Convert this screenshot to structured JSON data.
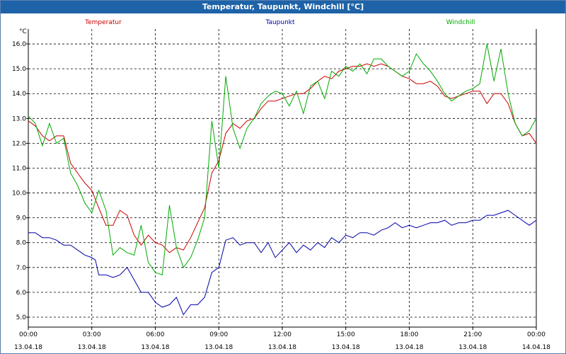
{
  "window_title": "Temperatur, Taupunkt, Windchill [°C]",
  "chart_data": {
    "type": "line",
    "title": "Temperatur, Taupunkt, Windchill [°C]",
    "ylabel": "°C",
    "ylim": [
      4.6,
      16.6
    ],
    "xlim": [
      0,
      24
    ],
    "grid": true,
    "legend_position": "top",
    "y_ticks": [
      "5.0",
      "6.0",
      "7.0",
      "8.0",
      "9.0",
      "10.0",
      "11.0",
      "12.0",
      "13.0",
      "14.0",
      "15.0",
      "16.0"
    ],
    "x_ticks": [
      {
        "time": "00:00",
        "date": "13.04.18"
      },
      {
        "time": "03:00",
        "date": "13.04.18"
      },
      {
        "time": "06:00",
        "date": "13.04.18"
      },
      {
        "time": "09:00",
        "date": "13.04.18"
      },
      {
        "time": "12:00",
        "date": "13.04.18"
      },
      {
        "time": "15:00",
        "date": "13.04.18"
      },
      {
        "time": "18:00",
        "date": "13.04.18"
      },
      {
        "time": "21:00",
        "date": "13.04.18"
      },
      {
        "time": "00:00",
        "date": "14.04.18"
      }
    ],
    "series": [
      {
        "name": "Temperatur",
        "color": "#cc0000",
        "points": [
          [
            0,
            12.9
          ],
          [
            0.33,
            12.7
          ],
          [
            0.67,
            12.3
          ],
          [
            1.0,
            12.1
          ],
          [
            1.33,
            12.3
          ],
          [
            1.67,
            12.3
          ],
          [
            2.0,
            11.2
          ],
          [
            2.33,
            10.8
          ],
          [
            2.67,
            10.4
          ],
          [
            3.0,
            10.1
          ],
          [
            3.33,
            9.4
          ],
          [
            3.67,
            8.7
          ],
          [
            4.0,
            8.7
          ],
          [
            4.33,
            9.3
          ],
          [
            4.67,
            9.1
          ],
          [
            5.0,
            8.3
          ],
          [
            5.33,
            7.9
          ],
          [
            5.67,
            8.3
          ],
          [
            6.0,
            8.0
          ],
          [
            6.33,
            7.9
          ],
          [
            6.67,
            7.6
          ],
          [
            7.0,
            7.8
          ],
          [
            7.33,
            7.7
          ],
          [
            7.67,
            8.2
          ],
          [
            8.0,
            8.8
          ],
          [
            8.33,
            9.4
          ],
          [
            8.67,
            10.8
          ],
          [
            9.0,
            11.3
          ],
          [
            9.33,
            12.4
          ],
          [
            9.67,
            12.8
          ],
          [
            10.0,
            12.6
          ],
          [
            10.33,
            12.9
          ],
          [
            10.67,
            13.0
          ],
          [
            11.0,
            13.4
          ],
          [
            11.33,
            13.7
          ],
          [
            11.67,
            13.7
          ],
          [
            12.0,
            13.8
          ],
          [
            12.33,
            13.9
          ],
          [
            12.67,
            14.0
          ],
          [
            13.0,
            14.0
          ],
          [
            13.33,
            14.2
          ],
          [
            13.67,
            14.5
          ],
          [
            14.0,
            14.7
          ],
          [
            14.33,
            14.6
          ],
          [
            14.67,
            14.9
          ],
          [
            15.0,
            15.0
          ],
          [
            15.33,
            15.1
          ],
          [
            15.67,
            15.1
          ],
          [
            16.0,
            15.2
          ],
          [
            16.33,
            15.1
          ],
          [
            16.67,
            15.2
          ],
          [
            17.0,
            15.1
          ],
          [
            17.33,
            14.9
          ],
          [
            17.67,
            14.7
          ],
          [
            18.0,
            14.6
          ],
          [
            18.33,
            14.4
          ],
          [
            18.67,
            14.4
          ],
          [
            19.0,
            14.5
          ],
          [
            19.33,
            14.3
          ],
          [
            19.67,
            13.9
          ],
          [
            20.0,
            13.8
          ],
          [
            20.33,
            13.9
          ],
          [
            20.67,
            14.0
          ],
          [
            21.0,
            14.1
          ],
          [
            21.33,
            14.1
          ],
          [
            21.67,
            13.6
          ],
          [
            22.0,
            14.0
          ],
          [
            22.33,
            14.0
          ],
          [
            22.67,
            13.6
          ],
          [
            23.0,
            12.8
          ],
          [
            23.33,
            12.3
          ],
          [
            23.67,
            12.4
          ],
          [
            24.0,
            12.0
          ]
        ]
      },
      {
        "name": "Taupunkt",
        "color": "#0000aa",
        "points": [
          [
            0,
            8.4
          ],
          [
            0.33,
            8.4
          ],
          [
            0.67,
            8.2
          ],
          [
            1.0,
            8.2
          ],
          [
            1.33,
            8.1
          ],
          [
            1.67,
            7.9
          ],
          [
            2.0,
            7.9
          ],
          [
            2.33,
            7.7
          ],
          [
            2.67,
            7.5
          ],
          [
            3.0,
            7.4
          ],
          [
            3.17,
            7.3
          ],
          [
            3.33,
            6.7
          ],
          [
            3.67,
            6.7
          ],
          [
            4.0,
            6.6
          ],
          [
            4.33,
            6.7
          ],
          [
            4.67,
            7.0
          ],
          [
            5.0,
            6.5
          ],
          [
            5.33,
            6.0
          ],
          [
            5.67,
            6.0
          ],
          [
            6.0,
            5.6
          ],
          [
            6.33,
            5.4
          ],
          [
            6.67,
            5.5
          ],
          [
            7.0,
            5.8
          ],
          [
            7.33,
            5.1
          ],
          [
            7.67,
            5.5
          ],
          [
            8.0,
            5.5
          ],
          [
            8.33,
            5.8
          ],
          [
            8.67,
            6.8
          ],
          [
            9.0,
            7.0
          ],
          [
            9.33,
            8.1
          ],
          [
            9.67,
            8.2
          ],
          [
            10.0,
            7.9
          ],
          [
            10.33,
            8.0
          ],
          [
            10.67,
            8.0
          ],
          [
            11.0,
            7.6
          ],
          [
            11.33,
            8.0
          ],
          [
            11.67,
            7.4
          ],
          [
            12.0,
            7.7
          ],
          [
            12.33,
            8.0
          ],
          [
            12.67,
            7.6
          ],
          [
            13.0,
            7.9
          ],
          [
            13.33,
            7.7
          ],
          [
            13.67,
            8.0
          ],
          [
            14.0,
            7.8
          ],
          [
            14.33,
            8.2
          ],
          [
            14.67,
            8.0
          ],
          [
            15.0,
            8.3
          ],
          [
            15.33,
            8.2
          ],
          [
            15.67,
            8.4
          ],
          [
            16.0,
            8.4
          ],
          [
            16.33,
            8.3
          ],
          [
            16.67,
            8.5
          ],
          [
            17.0,
            8.6
          ],
          [
            17.33,
            8.8
          ],
          [
            17.67,
            8.6
          ],
          [
            18.0,
            8.7
          ],
          [
            18.33,
            8.6
          ],
          [
            18.67,
            8.7
          ],
          [
            19.0,
            8.8
          ],
          [
            19.33,
            8.8
          ],
          [
            19.67,
            8.9
          ],
          [
            20.0,
            8.7
          ],
          [
            20.33,
            8.8
          ],
          [
            20.67,
            8.8
          ],
          [
            21.0,
            8.9
          ],
          [
            21.33,
            8.9
          ],
          [
            21.67,
            9.1
          ],
          [
            22.0,
            9.1
          ],
          [
            22.33,
            9.2
          ],
          [
            22.67,
            9.3
          ],
          [
            23.0,
            9.1
          ],
          [
            23.33,
            8.9
          ],
          [
            23.67,
            8.7
          ],
          [
            24.0,
            8.9
          ]
        ]
      },
      {
        "name": "Windchill",
        "color": "#00aa00",
        "points": [
          [
            0,
            13.1
          ],
          [
            0.33,
            12.8
          ],
          [
            0.67,
            11.9
          ],
          [
            1.0,
            12.8
          ],
          [
            1.33,
            12.0
          ],
          [
            1.67,
            12.2
          ],
          [
            2.0,
            10.8
          ],
          [
            2.33,
            10.3
          ],
          [
            2.67,
            9.6
          ],
          [
            3.0,
            9.2
          ],
          [
            3.33,
            10.1
          ],
          [
            3.67,
            9.3
          ],
          [
            4.0,
            7.5
          ],
          [
            4.33,
            7.8
          ],
          [
            4.67,
            7.6
          ],
          [
            5.0,
            7.5
          ],
          [
            5.33,
            8.7
          ],
          [
            5.67,
            7.2
          ],
          [
            6.0,
            6.8
          ],
          [
            6.33,
            6.7
          ],
          [
            6.67,
            9.5
          ],
          [
            7.0,
            7.8
          ],
          [
            7.33,
            7.0
          ],
          [
            7.67,
            7.4
          ],
          [
            8.0,
            8.1
          ],
          [
            8.33,
            9.0
          ],
          [
            8.67,
            12.9
          ],
          [
            9.0,
            11.0
          ],
          [
            9.33,
            14.7
          ],
          [
            9.67,
            12.6
          ],
          [
            10.0,
            11.8
          ],
          [
            10.33,
            12.6
          ],
          [
            10.67,
            13.0
          ],
          [
            11.0,
            13.6
          ],
          [
            11.33,
            13.9
          ],
          [
            11.67,
            14.1
          ],
          [
            12.0,
            14.0
          ],
          [
            12.33,
            13.5
          ],
          [
            12.67,
            14.1
          ],
          [
            13.0,
            13.2
          ],
          [
            13.33,
            14.3
          ],
          [
            13.67,
            14.5
          ],
          [
            14.0,
            13.8
          ],
          [
            14.33,
            14.9
          ],
          [
            14.67,
            14.7
          ],
          [
            15.0,
            15.1
          ],
          [
            15.33,
            14.9
          ],
          [
            15.67,
            15.2
          ],
          [
            16.0,
            14.8
          ],
          [
            16.33,
            15.4
          ],
          [
            16.67,
            15.4
          ],
          [
            17.0,
            15.1
          ],
          [
            17.33,
            14.9
          ],
          [
            17.67,
            14.7
          ],
          [
            18.0,
            14.9
          ],
          [
            18.33,
            15.6
          ],
          [
            18.67,
            15.2
          ],
          [
            19.0,
            14.9
          ],
          [
            19.33,
            14.5
          ],
          [
            19.67,
            14.0
          ],
          [
            20.0,
            13.7
          ],
          [
            20.33,
            13.9
          ],
          [
            20.67,
            14.1
          ],
          [
            21.0,
            14.2
          ],
          [
            21.33,
            14.4
          ],
          [
            21.67,
            16.0
          ],
          [
            22.0,
            14.5
          ],
          [
            22.33,
            15.8
          ],
          [
            22.67,
            14.0
          ],
          [
            23.0,
            12.8
          ],
          [
            23.33,
            12.3
          ],
          [
            23.67,
            12.5
          ],
          [
            24.0,
            13.0
          ]
        ]
      }
    ]
  }
}
